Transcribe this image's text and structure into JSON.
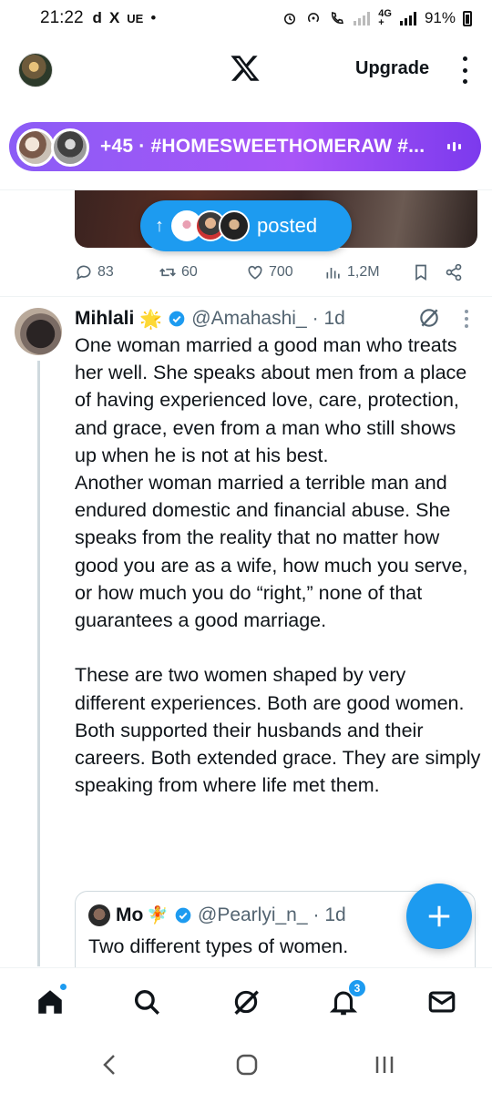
{
  "status_bar": {
    "time": "21:22",
    "left_icons": [
      "d",
      "X",
      "UE",
      "•"
    ],
    "battery": "91%"
  },
  "header": {
    "upgrade_label": "Upgrade"
  },
  "spaces": {
    "text": "+45 · #HOMESWEETHOMERAW #..."
  },
  "posted": {
    "label": "posted"
  },
  "prev_tweet_actions": {
    "replies": "83",
    "reposts": "60",
    "likes": "700",
    "views": "1,2M"
  },
  "tweet": {
    "name": "Mihlali",
    "emoji": "🌟",
    "handle": "@Amahashi_",
    "time": "· 1d",
    "text": "One woman married a good man who treats her well. She speaks about men from a place of having experienced love, care, protection, and grace, even from a man who still shows up when he is not at his best.\nAnother woman married a terrible man and endured domestic and financial abuse. She speaks from the reality that no matter how good you are as a wife, how much you serve, or how much you do “right,” none of that guarantees a good marriage.\n\nThese are two women shaped by very different experiences. Both are good women. Both supported their husbands and their careers. Both extended grace. They are simply speaking from where life met them."
  },
  "quote": {
    "name": "Mo",
    "emoji": "🧚",
    "handle": "@Pearlyi_n_",
    "time": "· 1d",
    "text": "Two different types of women."
  },
  "bottom_nav": {
    "items": [
      "home-icon",
      "search-icon",
      "grok-icon",
      "notifications-icon",
      "messages-icon"
    ],
    "notification_count": "3"
  },
  "colors": {
    "accent": "#1d9bf0",
    "spaces_gradient_start": "#8b5cf6",
    "spaces_gradient_end": "#7c3aed",
    "secondary_text": "#536471"
  }
}
